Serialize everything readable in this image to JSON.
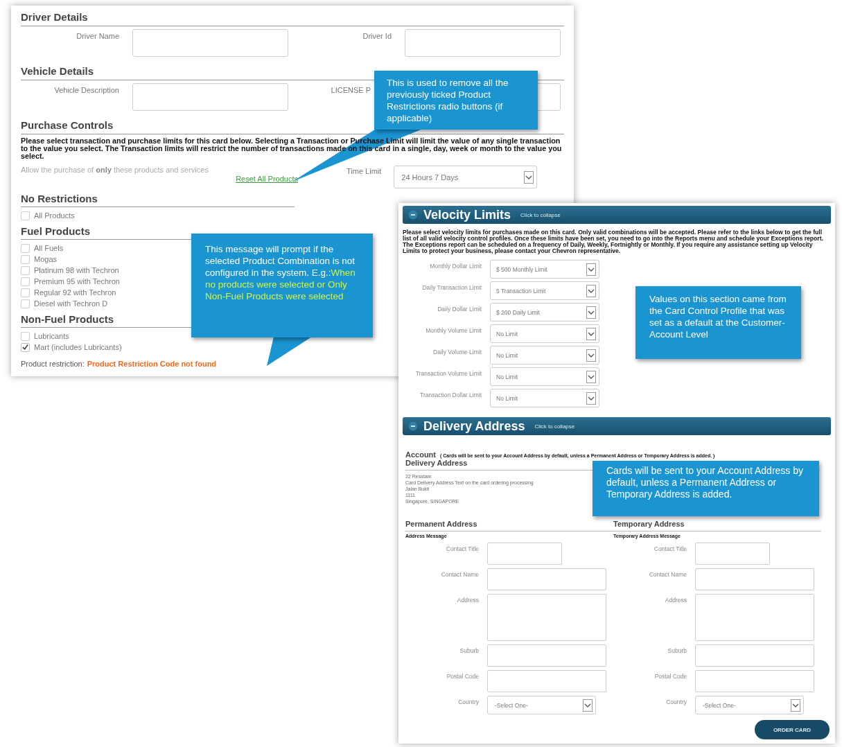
{
  "driver_details": {
    "title": "Driver Details",
    "fields": [
      {
        "label": "Driver Name"
      },
      {
        "label": "Driver Id"
      }
    ]
  },
  "vehicle_details": {
    "title": "Vehicle Details",
    "fields": [
      {
        "label": "Vehicle Description"
      },
      {
        "label": "LICENSE P"
      }
    ]
  },
  "purchase_controls": {
    "title": "Purchase Controls",
    "description": "Please select transaction and purchase limits for this card below. Selecting a Transaction or Purchase Limit will limit the value of any single transaction to the value you select. The Transaction limits will restrict the number of transactions made on this card in a single, day, week or month to the value you select.",
    "allow_text": "Allow the purchase of **only** these products and services",
    "reset_link": "Reset All Products",
    "time_limit": {
      "label": "Time Limit",
      "value": "24 Hours 7 Days"
    }
  },
  "product_groups": [
    {
      "title": "No Restrictions",
      "items": [
        {
          "label": "All Products",
          "checked": false
        }
      ]
    },
    {
      "title": "Fuel Products",
      "items": [
        {
          "label": "All Fuels",
          "checked": false
        },
        {
          "label": "Mogas",
          "checked": false
        },
        {
          "label": "Platinum 98 with Techron",
          "checked": false
        },
        {
          "label": "Premium 95 with Techron",
          "checked": false
        },
        {
          "label": "Regular 92 with Techron",
          "checked": false
        },
        {
          "label": "Diesel with Techron D",
          "checked": false
        }
      ]
    },
    {
      "title": "Non-Fuel Products",
      "items": [
        {
          "label": "Lubricants",
          "checked": false
        },
        {
          "label": "Mart (includes Lubricants)",
          "checked": true
        }
      ]
    }
  ],
  "product_restriction": {
    "label": "Product restriction:",
    "message": "Product Restriction Code not found"
  },
  "velocity_limits": {
    "title": "Velocity Limits",
    "collapse_hint": "Click to collapse",
    "description": "Please select velocity limits for purchases made on this card. Only valid combinations will be accepted. Please refer to the links below to get the full list of all valid velocity control profiles. Once these limits have been set, you need to go into the Reports menu and schedule your Exceptions report. The Exceptions report can be scheduled on a frequency of Daily, Weekly, Fortnightly or Monthly. If you require any assistance setting up Velocity Limits to protect your business, please contact your Chevron representative.",
    "limits": [
      {
        "label": "Monthly Dollar Limit",
        "value": "$ 500 Monthly Limit"
      },
      {
        "label": "Daily Transaction Limit",
        "value": "5 Transaction Limit"
      },
      {
        "label": "Daily Dollar Limit",
        "value": "$ 200 Daily Limit"
      },
      {
        "label": "Monthly Volume Limit",
        "value": "No Limit"
      },
      {
        "label": "Daily Volume Limit",
        "value": "No Limit"
      },
      {
        "label": "Transaction Volume Limit",
        "value": "No Limit"
      },
      {
        "label": "Transaction Dollar Limit",
        "value": "No Limit"
      }
    ]
  },
  "delivery_address": {
    "title": "Delivery Address",
    "collapse_hint": "Click to collapse",
    "account_label": "Account",
    "account_note": "( Cards will be sent to your Account Address by default, unless a Permanent Address or Temporary Address is added. )",
    "delivery_label": "Delivery Address",
    "address_lines": [
      "22 Residam",
      "Card Delivery Address Text on the card ordering processing",
      "Jalan Bukit",
      "1111",
      "Singapore, SINGAPORE"
    ],
    "columns": [
      {
        "title": "Permanent Address",
        "message": "Address Message",
        "fields": [
          {
            "label": "Contact Title",
            "kind": "short"
          },
          {
            "label": "Contact Name",
            "kind": "text"
          },
          {
            "label": "Address",
            "kind": "area"
          },
          {
            "label": "Suburb",
            "kind": "text"
          },
          {
            "label": "Postal Code",
            "kind": "text"
          },
          {
            "label": "Country",
            "kind": "select",
            "value": "-Select One-"
          }
        ]
      },
      {
        "title": "Temporary Address",
        "message": "Temporary Address Message",
        "fields": [
          {
            "label": "Contact Title",
            "kind": "short"
          },
          {
            "label": "Contact Name",
            "kind": "text"
          },
          {
            "label": "Address",
            "kind": "area"
          },
          {
            "label": "Suburb",
            "kind": "text"
          },
          {
            "label": "Postal Code",
            "kind": "text"
          },
          {
            "label": "Country",
            "kind": "select",
            "value": "-Select One-"
          }
        ]
      }
    ],
    "order_button": "ORDER CARD"
  },
  "callouts": [
    {
      "text": "This is used to remove all the previously ticked Product Restrictions radio buttons (if applicable)"
    },
    {
      "text": "This message will prompt if the selected Product Combination is not configured in the system. E.g.:",
      "highlight": "When no products were selected or Only Non-Fuel Products were selected"
    },
    {
      "text": "Values on this section came from the Card Control  Profile that was set as a default at the Customer-Account Level"
    },
    {
      "text": "Cards will be sent to your Account Address by default, unless a Permanent Address or Temporary Address is added."
    }
  ]
}
